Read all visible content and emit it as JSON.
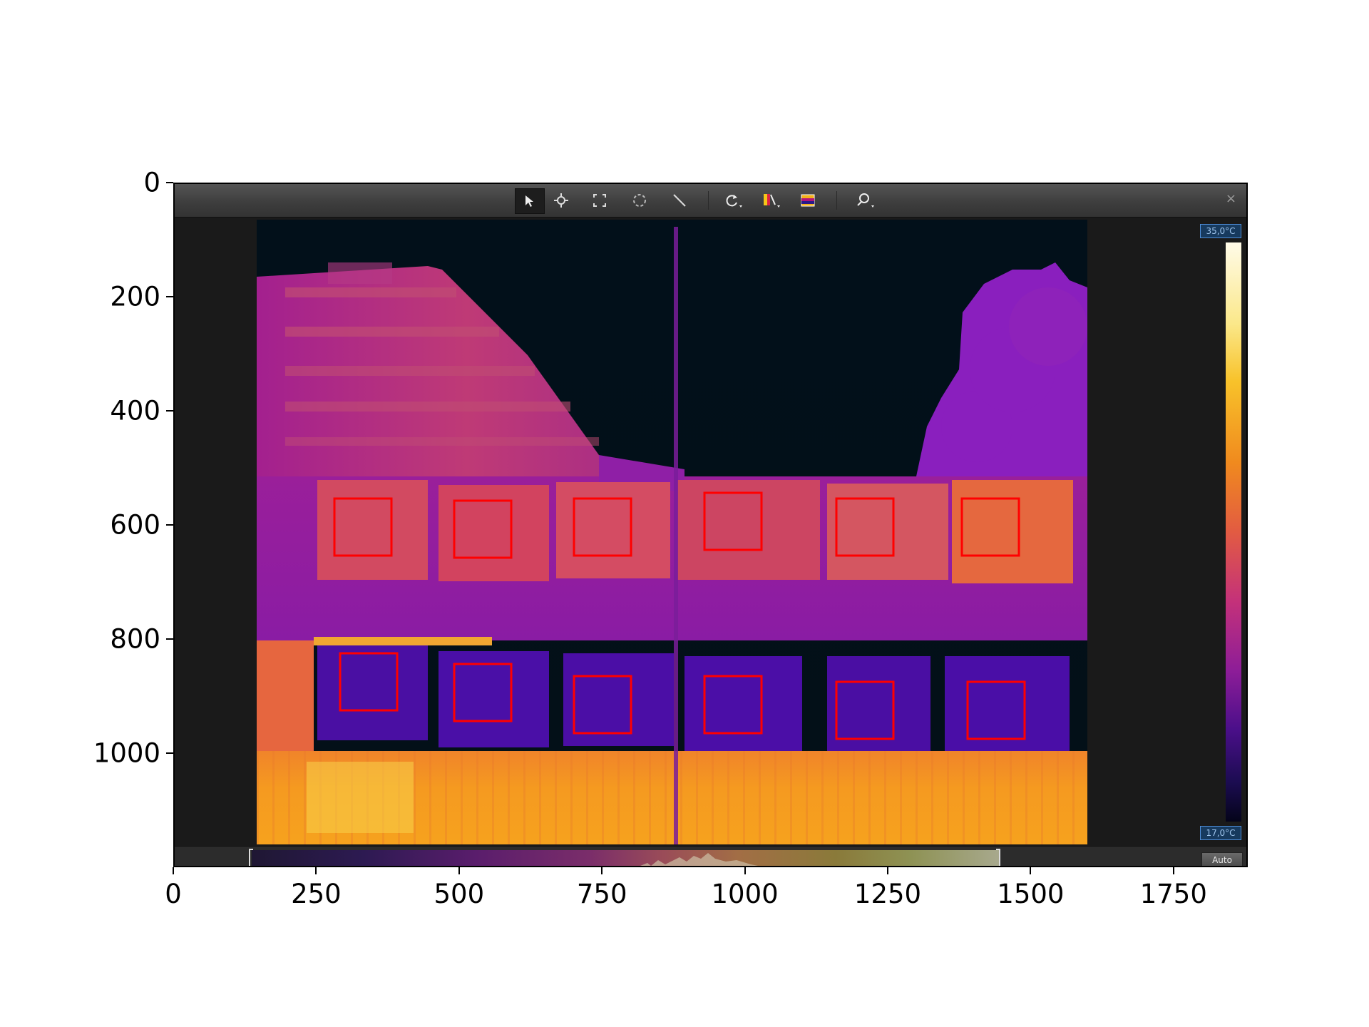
{
  "chart_data": {
    "type": "image",
    "x_ticks": [
      "0",
      "250",
      "500",
      "750",
      "1000",
      "1250",
      "1500",
      "1750"
    ],
    "y_ticks": [
      "0",
      "200",
      "400",
      "600",
      "800",
      "1000"
    ],
    "xlim": [
      0,
      1880
    ],
    "ylim": [
      1200,
      0
    ]
  },
  "toolbar": {
    "tools": [
      "select-arrow",
      "spot-meter",
      "box-measure",
      "circle-measure",
      "line-measure",
      "rotate",
      "palette",
      "image-mode",
      "zoom"
    ],
    "close_label": "×"
  },
  "scale": {
    "max_label": "35,0°C",
    "min_label": "17,0°C"
  },
  "range": {
    "auto_label": "Auto"
  },
  "measurement_boxes": {
    "color": "#ff0000",
    "count": 12
  }
}
